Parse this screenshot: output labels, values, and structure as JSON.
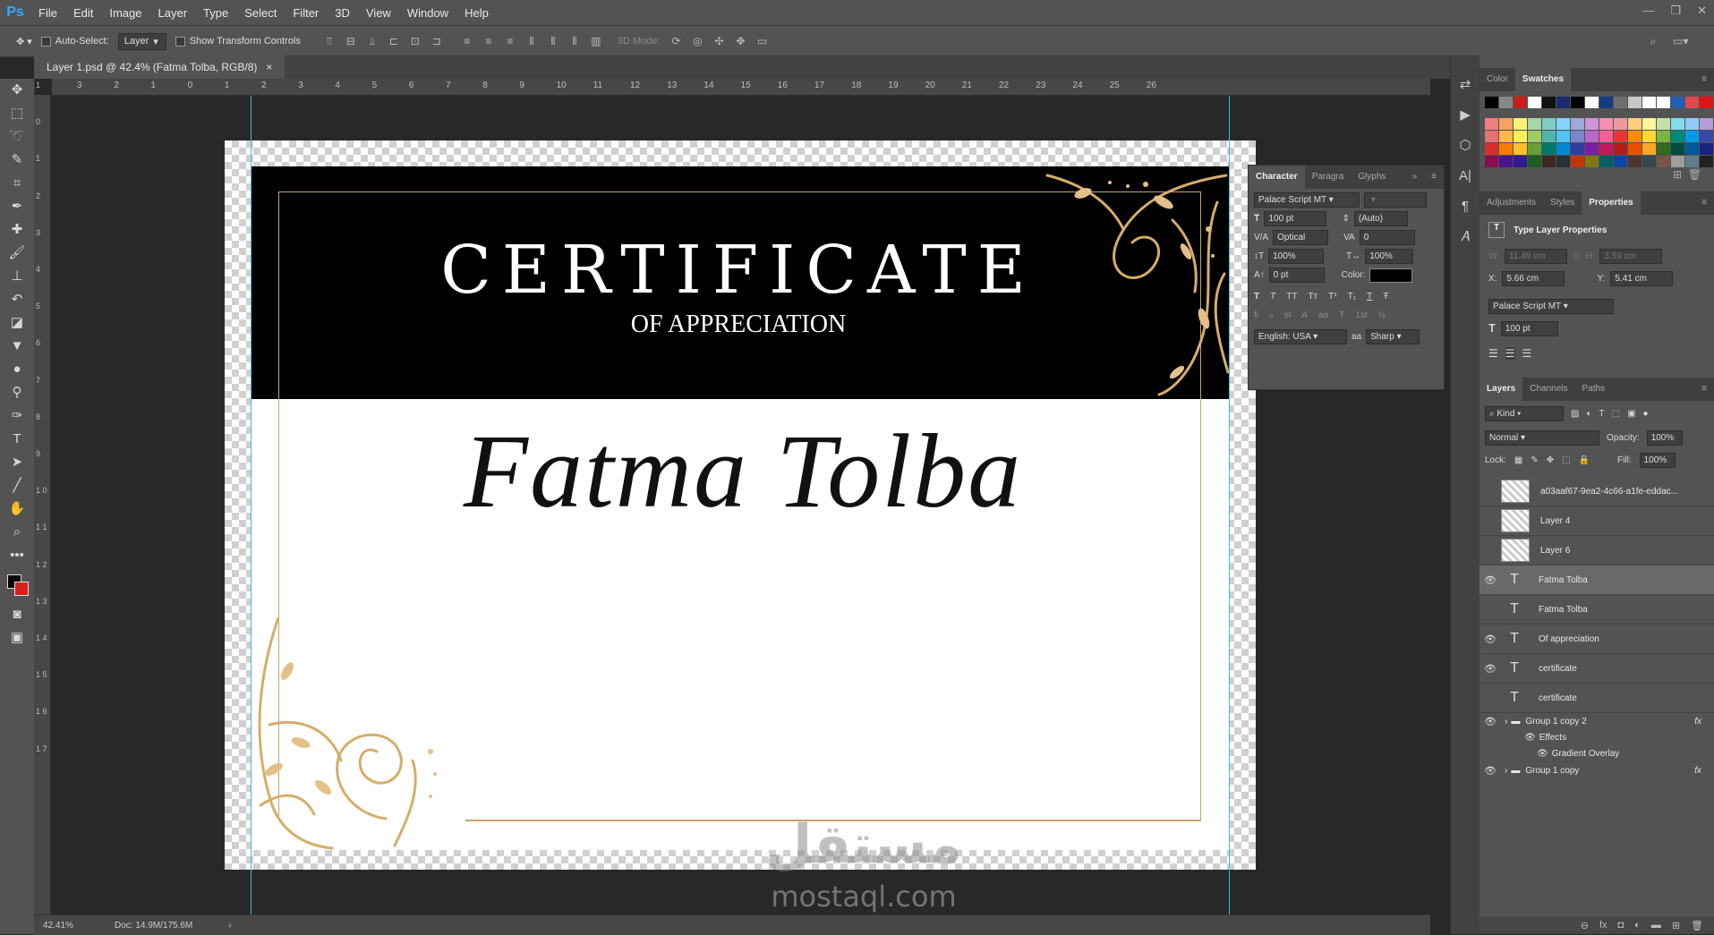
{
  "app": {
    "logo": "Ps"
  },
  "menu": [
    "File",
    "Edit",
    "Image",
    "Layer",
    "Type",
    "Select",
    "Filter",
    "3D",
    "View",
    "Window",
    "Help"
  ],
  "window_controls": [
    "—",
    "❐",
    "✕"
  ],
  "options": {
    "auto_select_label": "Auto-Select:",
    "auto_select_value": "Layer",
    "transform_label": "Show Transform Controls",
    "mode_3d": "3D Mode:"
  },
  "document": {
    "tab_title": "Layer 1.psd @ 42.4% (Fatma Tolba, RGB/8)",
    "close": "×"
  },
  "ruler": {
    "h_ticks": [
      "3",
      "2",
      "1",
      "0",
      "1",
      "2",
      "3",
      "4",
      "5",
      "6",
      "7",
      "8",
      "9",
      "10",
      "11",
      "12",
      "13",
      "14",
      "15",
      "16",
      "17",
      "18",
      "19",
      "20",
      "21",
      "22",
      "23",
      "24",
      "25",
      "26"
    ],
    "v_ticks": [
      "1",
      "0",
      "1",
      "2",
      "3",
      "4",
      "5",
      "6",
      "7",
      "8",
      "9",
      "1 0",
      "1 1",
      "1 2",
      "1 3",
      "1 4",
      "1 5",
      "1 6",
      "1 7"
    ]
  },
  "certificate": {
    "title": "CERTIFICATE",
    "subtitle": "OF APPRECIATION",
    "name": "Fatma Tolba"
  },
  "watermark": {
    "logo": "مستقل",
    "url": "mostaql.com"
  },
  "status": {
    "zoom": "42.41%",
    "doc": "Doc: 14.9M/175.6M"
  },
  "character_panel": {
    "tabs": [
      "Character",
      "Paragra",
      "Glyphs"
    ],
    "font": "Palace Script MT",
    "size": "100 pt",
    "leading": "(Auto)",
    "kerning": "Optical",
    "tracking": "0",
    "vscale": "100%",
    "hscale": "100%",
    "baseline": "0 pt",
    "color_label": "Color:",
    "style_buttons": [
      "T",
      "T",
      "TT",
      "Tт",
      "T¹",
      "T₁",
      "T",
      "Ŧ"
    ],
    "opentype_buttons": [
      "fi",
      "ℴ",
      "st",
      "A",
      "aa",
      "T",
      "1st",
      "½"
    ],
    "language": "English: USA",
    "aa_label": "aa",
    "antialias": "Sharp"
  },
  "color_panel": {
    "tabs": [
      "Color",
      "Swatches"
    ]
  },
  "swatches_row1": [
    "#000000",
    "#888888",
    "#c81e1e",
    "#ffffff",
    "#111111",
    "#1c2a6b",
    "#000000",
    "#ffffff",
    "#143c82",
    "#6e6e6e",
    "#c8c8c8",
    "#ffffff",
    "#ffffff",
    "#1e60b4",
    "#e04850",
    "#e01414"
  ],
  "swatches_rows": [
    [
      "#f08080",
      "#f4a460",
      "#fff176",
      "#a5d6a7",
      "#80cbc4",
      "#81d4fa",
      "#9fa8da",
      "#ce93d8",
      "#f48fb1",
      "#ef9a9a",
      "#ffcc80",
      "#fff59d",
      "#c5e1a5",
      "#80deea",
      "#90caf9",
      "#b39ddb"
    ],
    [
      "#e57373",
      "#ffb74d",
      "#ffee58",
      "#9ccc65",
      "#4db6ac",
      "#4fc3f7",
      "#7986cb",
      "#ba68c8",
      "#f06292",
      "#e53935",
      "#fb8c00",
      "#fdd835",
      "#7cb342",
      "#00897b",
      "#039be5",
      "#3949ab"
    ],
    [
      "#d32f2f",
      "#f57c00",
      "#fbc02d",
      "#689f38",
      "#00796b",
      "#0288d1",
      "#303f9f",
      "#7b1fa2",
      "#c2185b",
      "#b71c1c",
      "#e65100",
      "#f9a825",
      "#33691e",
      "#004d40",
      "#01579b",
      "#1a237e"
    ],
    [
      "#880e4f",
      "#4a148c",
      "#311b92",
      "#1b5e20",
      "#3e2723",
      "#263238",
      "#bf360c",
      "#827717",
      "#006064",
      "#0d47a1",
      "#4e342e",
      "#37474f",
      "#795548",
      "#9e9e9e",
      "#607d8b",
      "#212121"
    ]
  ],
  "properties_panel": {
    "tabs": [
      "Adjustments",
      "Styles",
      "Properties"
    ],
    "title": "Type Layer Properties",
    "w_label": "W:",
    "w": "11.49 cm",
    "h_label": "H:",
    "h": "3.59 cm",
    "x_label": "X:",
    "x": "5.66 cm",
    "y_label": "Y:",
    "y": "5.41 cm",
    "font": "Palace Script MT",
    "size": "100 pt"
  },
  "layers_panel": {
    "tabs": [
      "Layers",
      "Channels",
      "Paths"
    ],
    "kind": "Kind",
    "blend": "Normal",
    "opacity_label": "Opacity:",
    "opacity": "100%",
    "lock_label": "Lock:",
    "fill_label": "Fill:",
    "fill": "100%",
    "layers": [
      {
        "name": "a03aaf67-9ea2-4c66-a1fe-eddac...",
        "visible": false,
        "type": "image"
      },
      {
        "name": "Layer 4",
        "visible": false,
        "type": "image"
      },
      {
        "name": "Layer 6",
        "visible": false,
        "type": "image"
      },
      {
        "name": "Fatma Tolba",
        "visible": true,
        "type": "text",
        "selected": true
      },
      {
        "name": "Fatma Tolba",
        "visible": false,
        "type": "text"
      },
      {
        "name": "Of appreciation",
        "visible": true,
        "type": "text"
      },
      {
        "name": "certificate",
        "visible": true,
        "type": "text"
      },
      {
        "name": "certificate",
        "visible": false,
        "type": "text"
      }
    ],
    "group1": "Group 1 copy 2",
    "effects": "Effects",
    "gradient": "Gradient Overlay",
    "group2": "Group 1 copy"
  },
  "colors": {
    "accent_gold": "#c7a36b",
    "guide": "#38c0d6",
    "selected_row": "#696969"
  }
}
